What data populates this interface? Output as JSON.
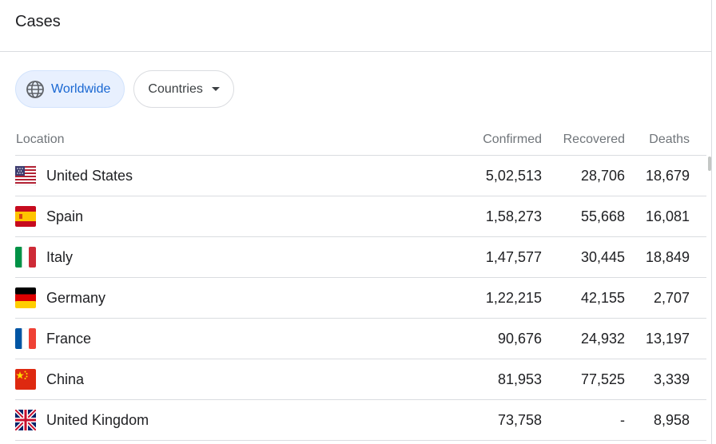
{
  "header": {
    "title": "Cases"
  },
  "filters": {
    "worldwide_label": "Worldwide",
    "countries_label": "Countries"
  },
  "table": {
    "headers": {
      "location": "Location",
      "confirmed": "Confirmed",
      "recovered": "Recovered",
      "deaths": "Deaths"
    },
    "rows": [
      {
        "location": "United States",
        "confirmed": "5,02,513",
        "recovered": "28,706",
        "deaths": "18,679",
        "flag": "us-flag-icon"
      },
      {
        "location": "Spain",
        "confirmed": "1,58,273",
        "recovered": "55,668",
        "deaths": "16,081",
        "flag": "spain-flag-icon"
      },
      {
        "location": "Italy",
        "confirmed": "1,47,577",
        "recovered": "30,445",
        "deaths": "18,849",
        "flag": "italy-flag-icon"
      },
      {
        "location": "Germany",
        "confirmed": "1,22,215",
        "recovered": "42,155",
        "deaths": "2,707",
        "flag": "germany-flag-icon"
      },
      {
        "location": "France",
        "confirmed": "90,676",
        "recovered": "24,932",
        "deaths": "13,197",
        "flag": "france-flag-icon"
      },
      {
        "location": "China",
        "confirmed": "81,953",
        "recovered": "77,525",
        "deaths": "3,339",
        "flag": "china-flag-icon"
      },
      {
        "location": "United Kingdom",
        "confirmed": "73,758",
        "recovered": "-",
        "deaths": "8,958",
        "flag": "uk-flag-icon"
      }
    ]
  },
  "colors": {
    "accent": "#1967d2",
    "chip_active_bg": "#e8f0fe",
    "divider": "#dadce0"
  }
}
